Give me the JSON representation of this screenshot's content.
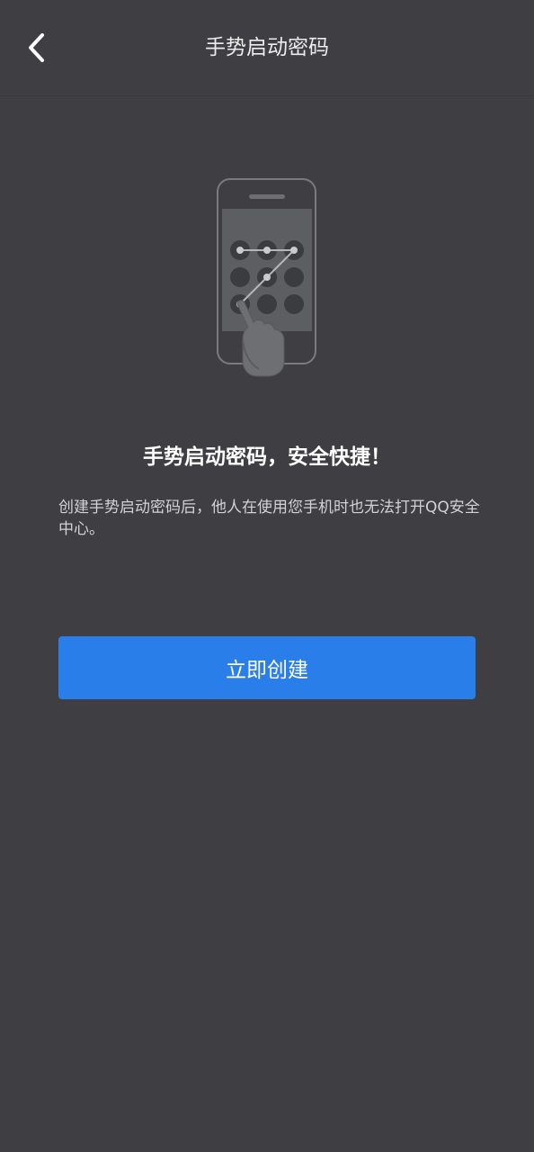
{
  "header": {
    "title": "手势启动密码",
    "back_icon": "chevron-left-icon"
  },
  "illustration": {
    "icon": "phone-gesture-lock-icon",
    "colors": {
      "phone_outline": "#7a7a80",
      "screen": "#5c5e62",
      "dot": "#3b3c40",
      "path": "#b4b6ba"
    }
  },
  "content": {
    "headline": "手势启动密码，安全快捷！",
    "description": "创建手势启动密码后，他人在使用您手机时也无法打开QQ安全中心。"
  },
  "actions": {
    "create_label": "立即创建"
  },
  "colors": {
    "background": "#3e3e43",
    "accent": "#2a7ee9",
    "text_primary": "#ffffff",
    "text_secondary": "#d2d2d6"
  }
}
